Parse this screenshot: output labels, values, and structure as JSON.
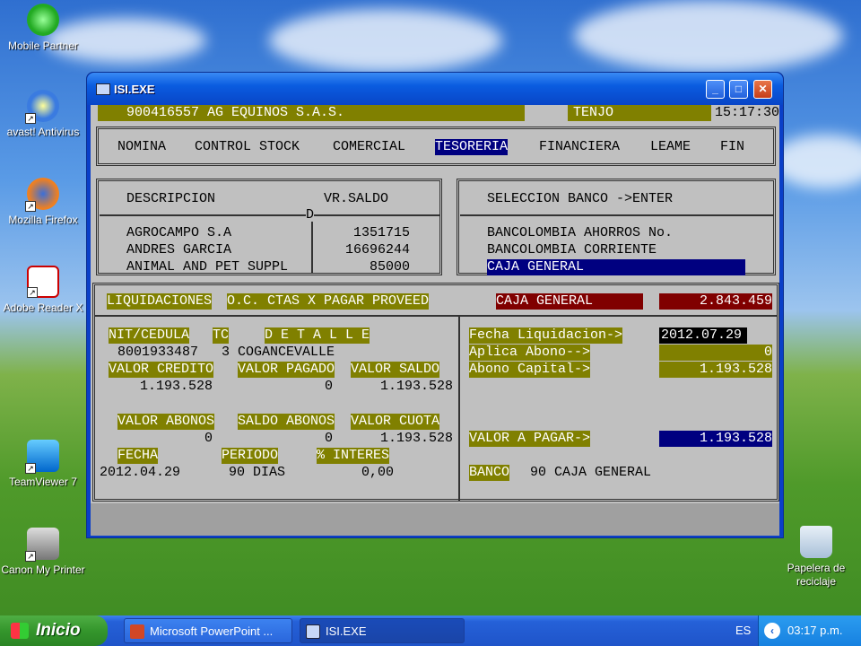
{
  "desktop": {
    "icons": [
      {
        "label": "Mobile Partner"
      },
      {
        "label": "avast! Antivirus"
      },
      {
        "label": "Mozilla Firefox"
      },
      {
        "label": "Adobe Reader X"
      },
      {
        "label": "TeamViewer 7"
      },
      {
        "label": "Canon My Printer"
      },
      {
        "label": "Papelera de reciclaje"
      }
    ]
  },
  "window": {
    "title": "ISI.EXE",
    "header": {
      "company": "900416557 AG EQUINOS S.A.S.",
      "location": "TENJO",
      "time": "15:17:30"
    },
    "menu": [
      "NOMINA",
      "CONTROL STOCK",
      "COMERCIAL",
      "TESORERIA",
      "FINANCIERA",
      "LEAME",
      "FIN"
    ],
    "menu_selected": "TESORERIA",
    "left_list": {
      "col1": "DESCRIPCION",
      "col2": "VR.SALDO",
      "marker": "D",
      "rows": [
        {
          "desc": "AGROCAMPO S.A",
          "value": "1351715"
        },
        {
          "desc": "ANDRES GARCIA",
          "value": "16696244"
        },
        {
          "desc": "ANIMAL AND PET SUPPL",
          "value": "85000"
        }
      ]
    },
    "bank_list": {
      "header": "SELECCION BANCO ->ENTER",
      "items": [
        "BANCOLOMBIA AHORROS No.",
        "BANCOLOMBIA CORRIENTE",
        "CAJA GENERAL"
      ],
      "selected": "CAJA GENERAL"
    },
    "summary": {
      "liquidaciones": "LIQUIDACIONES",
      "oc_label": "O.C. CTAS X PAGAR PROVEED",
      "caja_label": "CAJA GENERAL",
      "caja_value": "2.843.459"
    },
    "detail": {
      "h_nit": "NIT/CEDULA",
      "h_tc": "TC",
      "h_detalle": "D E T A L L E",
      "nit": "8001933487",
      "tc": "3",
      "detalle": "COGANCEVALLE",
      "h_valor_credito": "VALOR CREDITO",
      "h_valor_pagado": "VALOR PAGADO",
      "h_valor_saldo": "VALOR SALDO",
      "valor_credito": "1.193.528",
      "valor_pagado": "0",
      "valor_saldo": "1.193.528",
      "h_valor_abonos": "VALOR ABONOS",
      "h_saldo_abonos": "SALDO ABONOS",
      "h_valor_cuota": "VALOR CUOTA",
      "valor_abonos": "0",
      "saldo_abonos": "0",
      "valor_cuota": "1.193.528",
      "h_fecha": "FECHA",
      "h_periodo": "PERIODO",
      "h_interes": "% INTERES",
      "fecha": "2012.04.29",
      "periodo": "90 DIAS",
      "interes": "0,00"
    },
    "payment": {
      "fecha_liq_label": "Fecha Liquidacion->",
      "fecha_liq_value": "2012.07.29",
      "aplica_label": "Aplica Abono-->",
      "aplica_value": "0",
      "abono_label": "Abono Capital->",
      "abono_value": "1.193.528",
      "valor_pagar_label": "VALOR A PAGAR->",
      "valor_pagar_value": "1.193.528",
      "banco_label": "BANCO",
      "banco_value": "90 CAJA GENERAL"
    }
  },
  "taskbar": {
    "start": "Inicio",
    "tasks": [
      {
        "label": "Microsoft PowerPoint ..."
      },
      {
        "label": "ISI.EXE"
      }
    ],
    "lang": "ES",
    "clock": "03:17 p.m."
  },
  "colors": {
    "olive": "#808000",
    "maroon": "#800000",
    "navy": "#000080",
    "console_bg": "#c0c0c0"
  }
}
